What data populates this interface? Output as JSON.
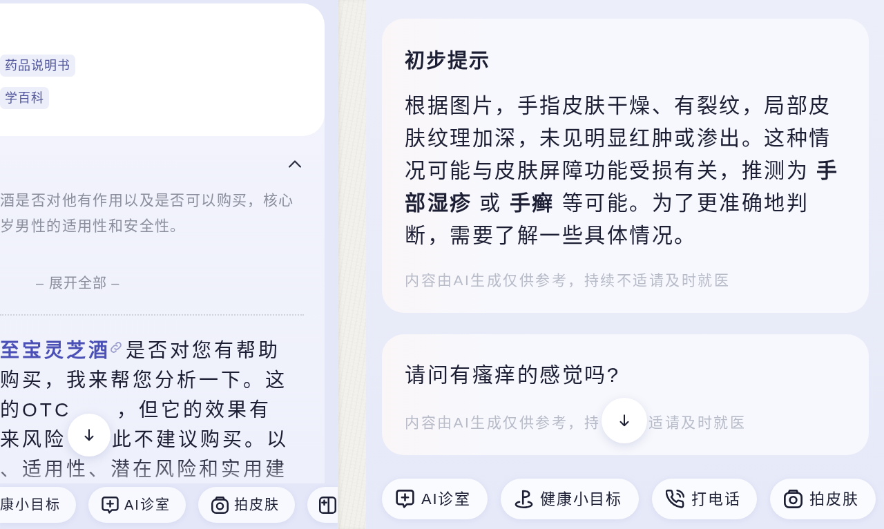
{
  "left_panel": {
    "reference_tags": [
      {
        "label": "药品说明书"
      },
      {
        "label": "学百科"
      }
    ],
    "thinking": {
      "expanded": true,
      "lines": [
        "酒是否对他有作用以及是否可以购买，核心",
        "岁男性的适用性和安全性。"
      ],
      "expand_label": "– 展开全部 –"
    },
    "answer": {
      "link": "至宝灵芝酒",
      "lines": [
        [
          "是否对您有帮助"
        ],
        [
          "购买，我来帮您分析一下。这"
        ],
        [
          "的OTC",
          "，但它的效果有"
        ],
        [
          "来风险",
          "此不建议购买。以"
        ],
        [
          "、适用性、潜在风险和实用建"
        ]
      ]
    },
    "quick_actions": [
      {
        "label": "康小目标"
      },
      {
        "kind": "clinic",
        "label": "AI诊室"
      },
      {
        "kind": "photo",
        "label": "拍皮肤"
      },
      {
        "kind": "add"
      }
    ]
  },
  "right_panel": {
    "messages": [
      {
        "title": "初步提示",
        "body": "根据图片，手指皮肤干燥、有裂纹，局部皮肤纹理加深，未见明显红肿或渗出。这种情况可能与皮肤屏障功能受损有关，推测为 **手部湿疹** 或 **手癣** 等可能。为了更准确地判断，需要了解一些具体情况。",
        "disclaimer": [
          "内容由AI生成仅供参考，持续不适请及时就医"
        ]
      },
      {
        "body": "请问有瘙痒的感觉吗?",
        "disclaimer": [
          "内容由AI生成仅供参考，持",
          "适请及时就医"
        ]
      }
    ],
    "quick_actions": [
      {
        "kind": "clinic",
        "label": "AI诊室"
      },
      {
        "kind": "goals",
        "label": "健康小目标"
      },
      {
        "kind": "call",
        "label": "打电话"
      },
      {
        "kind": "photo",
        "label": "拍皮肤"
      }
    ]
  }
}
